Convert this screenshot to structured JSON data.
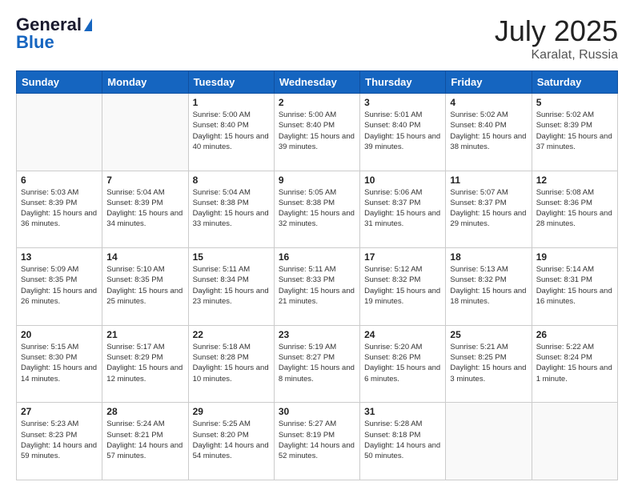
{
  "logo": {
    "line1": "General",
    "line2": "Blue"
  },
  "title": "July 2025",
  "location": "Karalat, Russia",
  "days_of_week": [
    "Sunday",
    "Monday",
    "Tuesday",
    "Wednesday",
    "Thursday",
    "Friday",
    "Saturday"
  ],
  "weeks": [
    [
      {
        "day": "",
        "sunrise": "",
        "sunset": "",
        "daylight": ""
      },
      {
        "day": "",
        "sunrise": "",
        "sunset": "",
        "daylight": ""
      },
      {
        "day": "1",
        "sunrise": "Sunrise: 5:00 AM",
        "sunset": "Sunset: 8:40 PM",
        "daylight": "Daylight: 15 hours and 40 minutes."
      },
      {
        "day": "2",
        "sunrise": "Sunrise: 5:00 AM",
        "sunset": "Sunset: 8:40 PM",
        "daylight": "Daylight: 15 hours and 39 minutes."
      },
      {
        "day": "3",
        "sunrise": "Sunrise: 5:01 AM",
        "sunset": "Sunset: 8:40 PM",
        "daylight": "Daylight: 15 hours and 39 minutes."
      },
      {
        "day": "4",
        "sunrise": "Sunrise: 5:02 AM",
        "sunset": "Sunset: 8:40 PM",
        "daylight": "Daylight: 15 hours and 38 minutes."
      },
      {
        "day": "5",
        "sunrise": "Sunrise: 5:02 AM",
        "sunset": "Sunset: 8:39 PM",
        "daylight": "Daylight: 15 hours and 37 minutes."
      }
    ],
    [
      {
        "day": "6",
        "sunrise": "Sunrise: 5:03 AM",
        "sunset": "Sunset: 8:39 PM",
        "daylight": "Daylight: 15 hours and 36 minutes."
      },
      {
        "day": "7",
        "sunrise": "Sunrise: 5:04 AM",
        "sunset": "Sunset: 8:39 PM",
        "daylight": "Daylight: 15 hours and 34 minutes."
      },
      {
        "day": "8",
        "sunrise": "Sunrise: 5:04 AM",
        "sunset": "Sunset: 8:38 PM",
        "daylight": "Daylight: 15 hours and 33 minutes."
      },
      {
        "day": "9",
        "sunrise": "Sunrise: 5:05 AM",
        "sunset": "Sunset: 8:38 PM",
        "daylight": "Daylight: 15 hours and 32 minutes."
      },
      {
        "day": "10",
        "sunrise": "Sunrise: 5:06 AM",
        "sunset": "Sunset: 8:37 PM",
        "daylight": "Daylight: 15 hours and 31 minutes."
      },
      {
        "day": "11",
        "sunrise": "Sunrise: 5:07 AM",
        "sunset": "Sunset: 8:37 PM",
        "daylight": "Daylight: 15 hours and 29 minutes."
      },
      {
        "day": "12",
        "sunrise": "Sunrise: 5:08 AM",
        "sunset": "Sunset: 8:36 PM",
        "daylight": "Daylight: 15 hours and 28 minutes."
      }
    ],
    [
      {
        "day": "13",
        "sunrise": "Sunrise: 5:09 AM",
        "sunset": "Sunset: 8:35 PM",
        "daylight": "Daylight: 15 hours and 26 minutes."
      },
      {
        "day": "14",
        "sunrise": "Sunrise: 5:10 AM",
        "sunset": "Sunset: 8:35 PM",
        "daylight": "Daylight: 15 hours and 25 minutes."
      },
      {
        "day": "15",
        "sunrise": "Sunrise: 5:11 AM",
        "sunset": "Sunset: 8:34 PM",
        "daylight": "Daylight: 15 hours and 23 minutes."
      },
      {
        "day": "16",
        "sunrise": "Sunrise: 5:11 AM",
        "sunset": "Sunset: 8:33 PM",
        "daylight": "Daylight: 15 hours and 21 minutes."
      },
      {
        "day": "17",
        "sunrise": "Sunrise: 5:12 AM",
        "sunset": "Sunset: 8:32 PM",
        "daylight": "Daylight: 15 hours and 19 minutes."
      },
      {
        "day": "18",
        "sunrise": "Sunrise: 5:13 AM",
        "sunset": "Sunset: 8:32 PM",
        "daylight": "Daylight: 15 hours and 18 minutes."
      },
      {
        "day": "19",
        "sunrise": "Sunrise: 5:14 AM",
        "sunset": "Sunset: 8:31 PM",
        "daylight": "Daylight: 15 hours and 16 minutes."
      }
    ],
    [
      {
        "day": "20",
        "sunrise": "Sunrise: 5:15 AM",
        "sunset": "Sunset: 8:30 PM",
        "daylight": "Daylight: 15 hours and 14 minutes."
      },
      {
        "day": "21",
        "sunrise": "Sunrise: 5:17 AM",
        "sunset": "Sunset: 8:29 PM",
        "daylight": "Daylight: 15 hours and 12 minutes."
      },
      {
        "day": "22",
        "sunrise": "Sunrise: 5:18 AM",
        "sunset": "Sunset: 8:28 PM",
        "daylight": "Daylight: 15 hours and 10 minutes."
      },
      {
        "day": "23",
        "sunrise": "Sunrise: 5:19 AM",
        "sunset": "Sunset: 8:27 PM",
        "daylight": "Daylight: 15 hours and 8 minutes."
      },
      {
        "day": "24",
        "sunrise": "Sunrise: 5:20 AM",
        "sunset": "Sunset: 8:26 PM",
        "daylight": "Daylight: 15 hours and 6 minutes."
      },
      {
        "day": "25",
        "sunrise": "Sunrise: 5:21 AM",
        "sunset": "Sunset: 8:25 PM",
        "daylight": "Daylight: 15 hours and 3 minutes."
      },
      {
        "day": "26",
        "sunrise": "Sunrise: 5:22 AM",
        "sunset": "Sunset: 8:24 PM",
        "daylight": "Daylight: 15 hours and 1 minute."
      }
    ],
    [
      {
        "day": "27",
        "sunrise": "Sunrise: 5:23 AM",
        "sunset": "Sunset: 8:23 PM",
        "daylight": "Daylight: 14 hours and 59 minutes."
      },
      {
        "day": "28",
        "sunrise": "Sunrise: 5:24 AM",
        "sunset": "Sunset: 8:21 PM",
        "daylight": "Daylight: 14 hours and 57 minutes."
      },
      {
        "day": "29",
        "sunrise": "Sunrise: 5:25 AM",
        "sunset": "Sunset: 8:20 PM",
        "daylight": "Daylight: 14 hours and 54 minutes."
      },
      {
        "day": "30",
        "sunrise": "Sunrise: 5:27 AM",
        "sunset": "Sunset: 8:19 PM",
        "daylight": "Daylight: 14 hours and 52 minutes."
      },
      {
        "day": "31",
        "sunrise": "Sunrise: 5:28 AM",
        "sunset": "Sunset: 8:18 PM",
        "daylight": "Daylight: 14 hours and 50 minutes."
      },
      {
        "day": "",
        "sunrise": "",
        "sunset": "",
        "daylight": ""
      },
      {
        "day": "",
        "sunrise": "",
        "sunset": "",
        "daylight": ""
      }
    ]
  ]
}
